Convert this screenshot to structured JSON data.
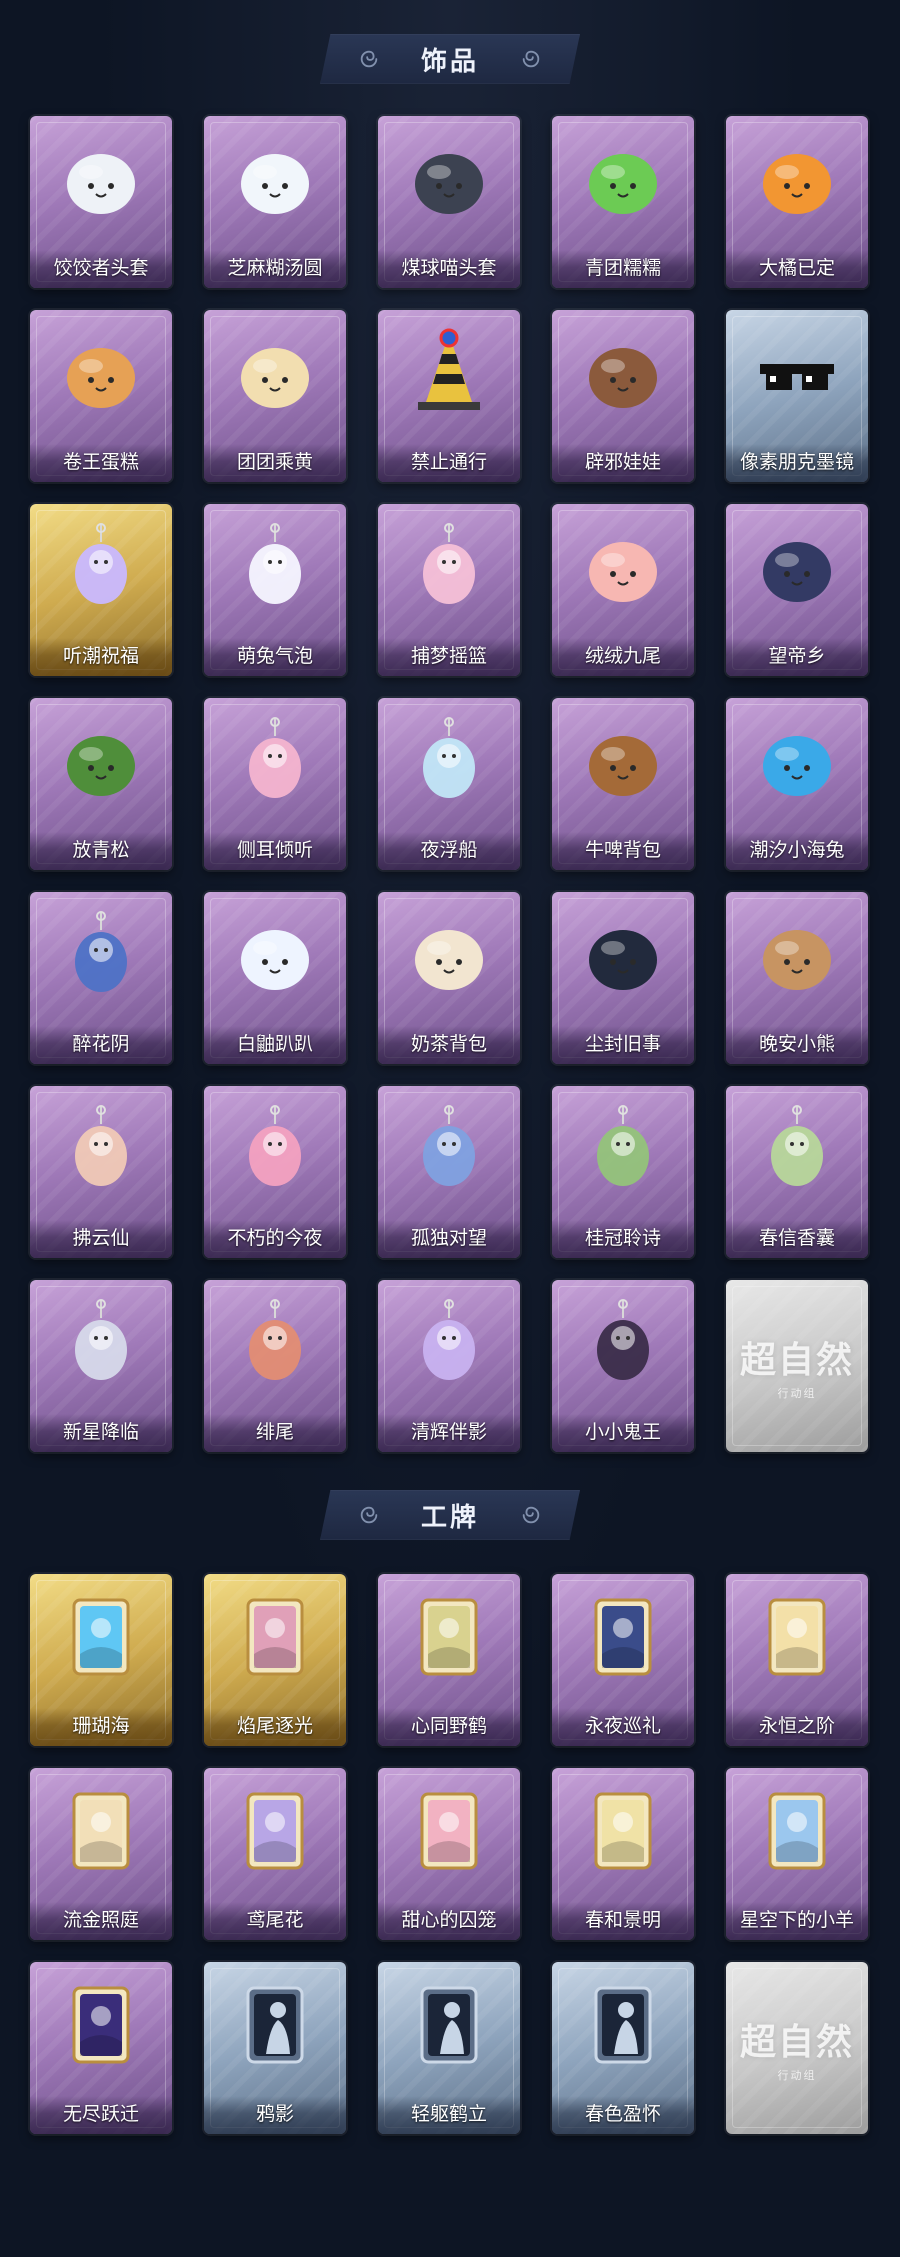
{
  "sections": [
    {
      "title": "饰品",
      "items": [
        {
          "label": "饺饺者头套",
          "tier": "purple",
          "icon": "white-dumpling-head-icon",
          "color": "#eef2f7"
        },
        {
          "label": "芝麻糊汤圆",
          "tier": "purple",
          "icon": "rice-ball-head-icon",
          "color": "#f1f6fb"
        },
        {
          "label": "煤球喵头套",
          "tier": "purple",
          "icon": "black-cat-head-icon",
          "color": "#3c4251"
        },
        {
          "label": "青团糯糯",
          "tier": "purple",
          "icon": "green-rice-ball-icon",
          "color": "#6ccb54"
        },
        {
          "label": "大橘已定",
          "tier": "purple",
          "icon": "orange-slice-icon",
          "color": "#f29632"
        },
        {
          "label": "卷王蛋糕",
          "tier": "purple",
          "icon": "roll-cake-icon",
          "color": "#e6a155"
        },
        {
          "label": "团团乘黄",
          "tier": "purple",
          "icon": "cream-beast-head-icon",
          "color": "#f2deb0"
        },
        {
          "label": "禁止通行",
          "tier": "purple",
          "icon": "traffic-cone-icon",
          "color": "#e9c23e"
        },
        {
          "label": "辟邪娃娃",
          "tier": "purple",
          "icon": "doll-head-icon",
          "color": "#8b5a3c"
        },
        {
          "label": "像素朋克墨镜",
          "tier": "blue",
          "icon": "pixel-sunglasses-icon",
          "color": "#111111"
        },
        {
          "label": "听潮祝福",
          "tier": "gold",
          "icon": "wing-ornament-icon",
          "color": "#c9b8ff"
        },
        {
          "label": "萌兔气泡",
          "tier": "purple",
          "icon": "bunny-bubble-icon",
          "color": "#f5f5ff"
        },
        {
          "label": "捕梦摇篮",
          "tier": "purple",
          "icon": "dream-cradle-icon",
          "color": "#f6c0d7"
        },
        {
          "label": "绒绒九尾",
          "tier": "purple",
          "icon": "nine-tail-fox-icon",
          "color": "#f7b7b2"
        },
        {
          "label": "望帝乡",
          "tier": "purple",
          "icon": "figure-companion-icon",
          "color": "#333a64"
        },
        {
          "label": "放青松",
          "tier": "purple",
          "icon": "bonsai-pine-icon",
          "color": "#4f8e3a"
        },
        {
          "label": "侧耳倾听",
          "tier": "purple",
          "icon": "flower-hoop-icon",
          "color": "#f4b4cf"
        },
        {
          "label": "夜浮船",
          "tier": "purple",
          "icon": "jellyfish-icon",
          "color": "#c1e6f7"
        },
        {
          "label": "牛啤背包",
          "tier": "purple",
          "icon": "beer-mug-backpack-icon",
          "color": "#a46a38"
        },
        {
          "label": "潮汐小海兔",
          "tier": "purple",
          "icon": "blue-sea-bunny-icon",
          "color": "#3aa9e8"
        },
        {
          "label": "醉花阴",
          "tier": "purple",
          "icon": "fan-pendant-icon",
          "color": "#4e72c6"
        },
        {
          "label": "白鼬趴趴",
          "tier": "purple",
          "icon": "ermine-plush-icon",
          "color": "#eef4ff"
        },
        {
          "label": "奶茶背包",
          "tier": "purple",
          "icon": "milk-tea-backpack-icon",
          "color": "#f2e5d0"
        },
        {
          "label": "尘封旧事",
          "tier": "purple",
          "icon": "chibi-figure-icon",
          "color": "#222a3d"
        },
        {
          "label": "晚安小熊",
          "tier": "purple",
          "icon": "bear-plush-icon",
          "color": "#c79462"
        },
        {
          "label": "拂云仙",
          "tier": "purple",
          "icon": "cloud-fairy-charm-icon",
          "color": "#f0c9b6"
        },
        {
          "label": "不朽的今夜",
          "tier": "purple",
          "icon": "pink-cat-charm-icon",
          "color": "#f3a1c0"
        },
        {
          "label": "孤独对望",
          "tier": "purple",
          "icon": "blue-figure-charm-icon",
          "color": "#7fa1e0"
        },
        {
          "label": "桂冠聆诗",
          "tier": "purple",
          "icon": "green-figure-charm-icon",
          "color": "#93c37a"
        },
        {
          "label": "春信香囊",
          "tier": "purple",
          "icon": "sachet-icon",
          "color": "#b7d79a"
        },
        {
          "label": "新星降临",
          "tier": "purple",
          "icon": "star-figure-charm-icon",
          "color": "#d6d9ea"
        },
        {
          "label": "绯尾",
          "tier": "purple",
          "icon": "red-fox-charm-icon",
          "color": "#e38d73"
        },
        {
          "label": "清辉伴影",
          "tier": "purple",
          "icon": "lilac-figure-charm-icon",
          "color": "#c8b2f0"
        },
        {
          "label": "小小鬼王",
          "tier": "purple",
          "icon": "demon-king-charm-icon",
          "color": "#3b2d4a"
        },
        {
          "label": "",
          "tier": "grey",
          "icon": "brand-placeholder-icon",
          "placeholder": {
            "brand": "超自然",
            "sub": "行动组"
          }
        }
      ]
    },
    {
      "title": "工牌",
      "items": [
        {
          "label": "珊瑚海",
          "tier": "gold",
          "icon": "badge-card-icon",
          "color": "#5fc7f4"
        },
        {
          "label": "焰尾逐光",
          "tier": "gold",
          "icon": "badge-card-icon",
          "color": "#e0a0b8"
        },
        {
          "label": "心同野鹤",
          "tier": "purple",
          "icon": "badge-card-icon",
          "color": "#d9d28f"
        },
        {
          "label": "永夜巡礼",
          "tier": "purple",
          "icon": "badge-card-icon",
          "color": "#3a4c8a"
        },
        {
          "label": "永恒之阶",
          "tier": "purple",
          "icon": "badge-card-icon",
          "color": "#f3e0a8"
        },
        {
          "label": "流金照庭",
          "tier": "purple",
          "icon": "badge-card-icon",
          "color": "#f2dfb8"
        },
        {
          "label": "鸢尾花",
          "tier": "purple",
          "icon": "badge-card-icon",
          "color": "#b8a6e6"
        },
        {
          "label": "甜心的囚笼",
          "tier": "purple",
          "icon": "badge-card-icon",
          "color": "#f2b2c2"
        },
        {
          "label": "春和景明",
          "tier": "purple",
          "icon": "badge-card-icon",
          "color": "#f0e2a6"
        },
        {
          "label": "星空下的小羊",
          "tier": "purple",
          "icon": "badge-card-icon",
          "color": "#9bc7ee"
        },
        {
          "label": "无尽跃迁",
          "tier": "purple",
          "icon": "badge-card-icon",
          "color": "#3a2d7a"
        },
        {
          "label": "鸦影",
          "tier": "blue",
          "icon": "silhouette-badge-icon",
          "color": "#1b2538"
        },
        {
          "label": "轻躯鹤立",
          "tier": "blue",
          "icon": "silhouette-badge-icon",
          "color": "#1b2538"
        },
        {
          "label": "春色盈怀",
          "tier": "blue",
          "icon": "silhouette-badge-icon",
          "color": "#1b2538"
        },
        {
          "label": "",
          "tier": "grey",
          "icon": "brand-placeholder-icon",
          "placeholder": {
            "brand": "超自然",
            "sub": "行动组"
          }
        }
      ]
    }
  ]
}
